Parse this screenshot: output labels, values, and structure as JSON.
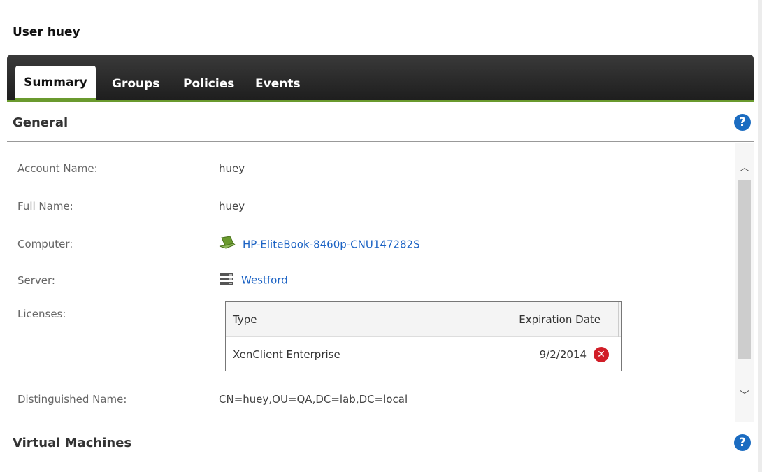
{
  "page": {
    "title": "User huey"
  },
  "tabs": [
    {
      "label": "Summary",
      "active": true
    },
    {
      "label": "Groups",
      "active": false
    },
    {
      "label": "Policies",
      "active": false
    },
    {
      "label": "Events",
      "active": false
    }
  ],
  "general": {
    "title": "General",
    "help": "?",
    "account_name": {
      "label": "Account Name:",
      "value": "huey"
    },
    "full_name": {
      "label": "Full Name:",
      "value": "huey"
    },
    "computer": {
      "label": "Computer:",
      "value": "HP-EliteBook-8460p-CNU147282S",
      "icon": "laptop-icon"
    },
    "server": {
      "label": "Server:",
      "value": "Westford",
      "icon": "server-icon"
    },
    "licenses": {
      "label": "Licenses:",
      "columns": [
        "Type",
        "Expiration Date"
      ],
      "rows": [
        {
          "type": "XenClient Enterprise",
          "expiration": "9/2/2014",
          "status_icon": "error-icon"
        }
      ]
    },
    "distinguished_name": {
      "label": "Distinguished Name:",
      "value": "CN=huey,OU=QA,DC=lab,DC=local"
    }
  },
  "vms": {
    "title": "Virtual Machines",
    "help": "?"
  },
  "colors": {
    "accent_green": "#6a9a2e",
    "link": "#1c63c4",
    "help": "#1b6cc1",
    "error": "#d11d27"
  }
}
